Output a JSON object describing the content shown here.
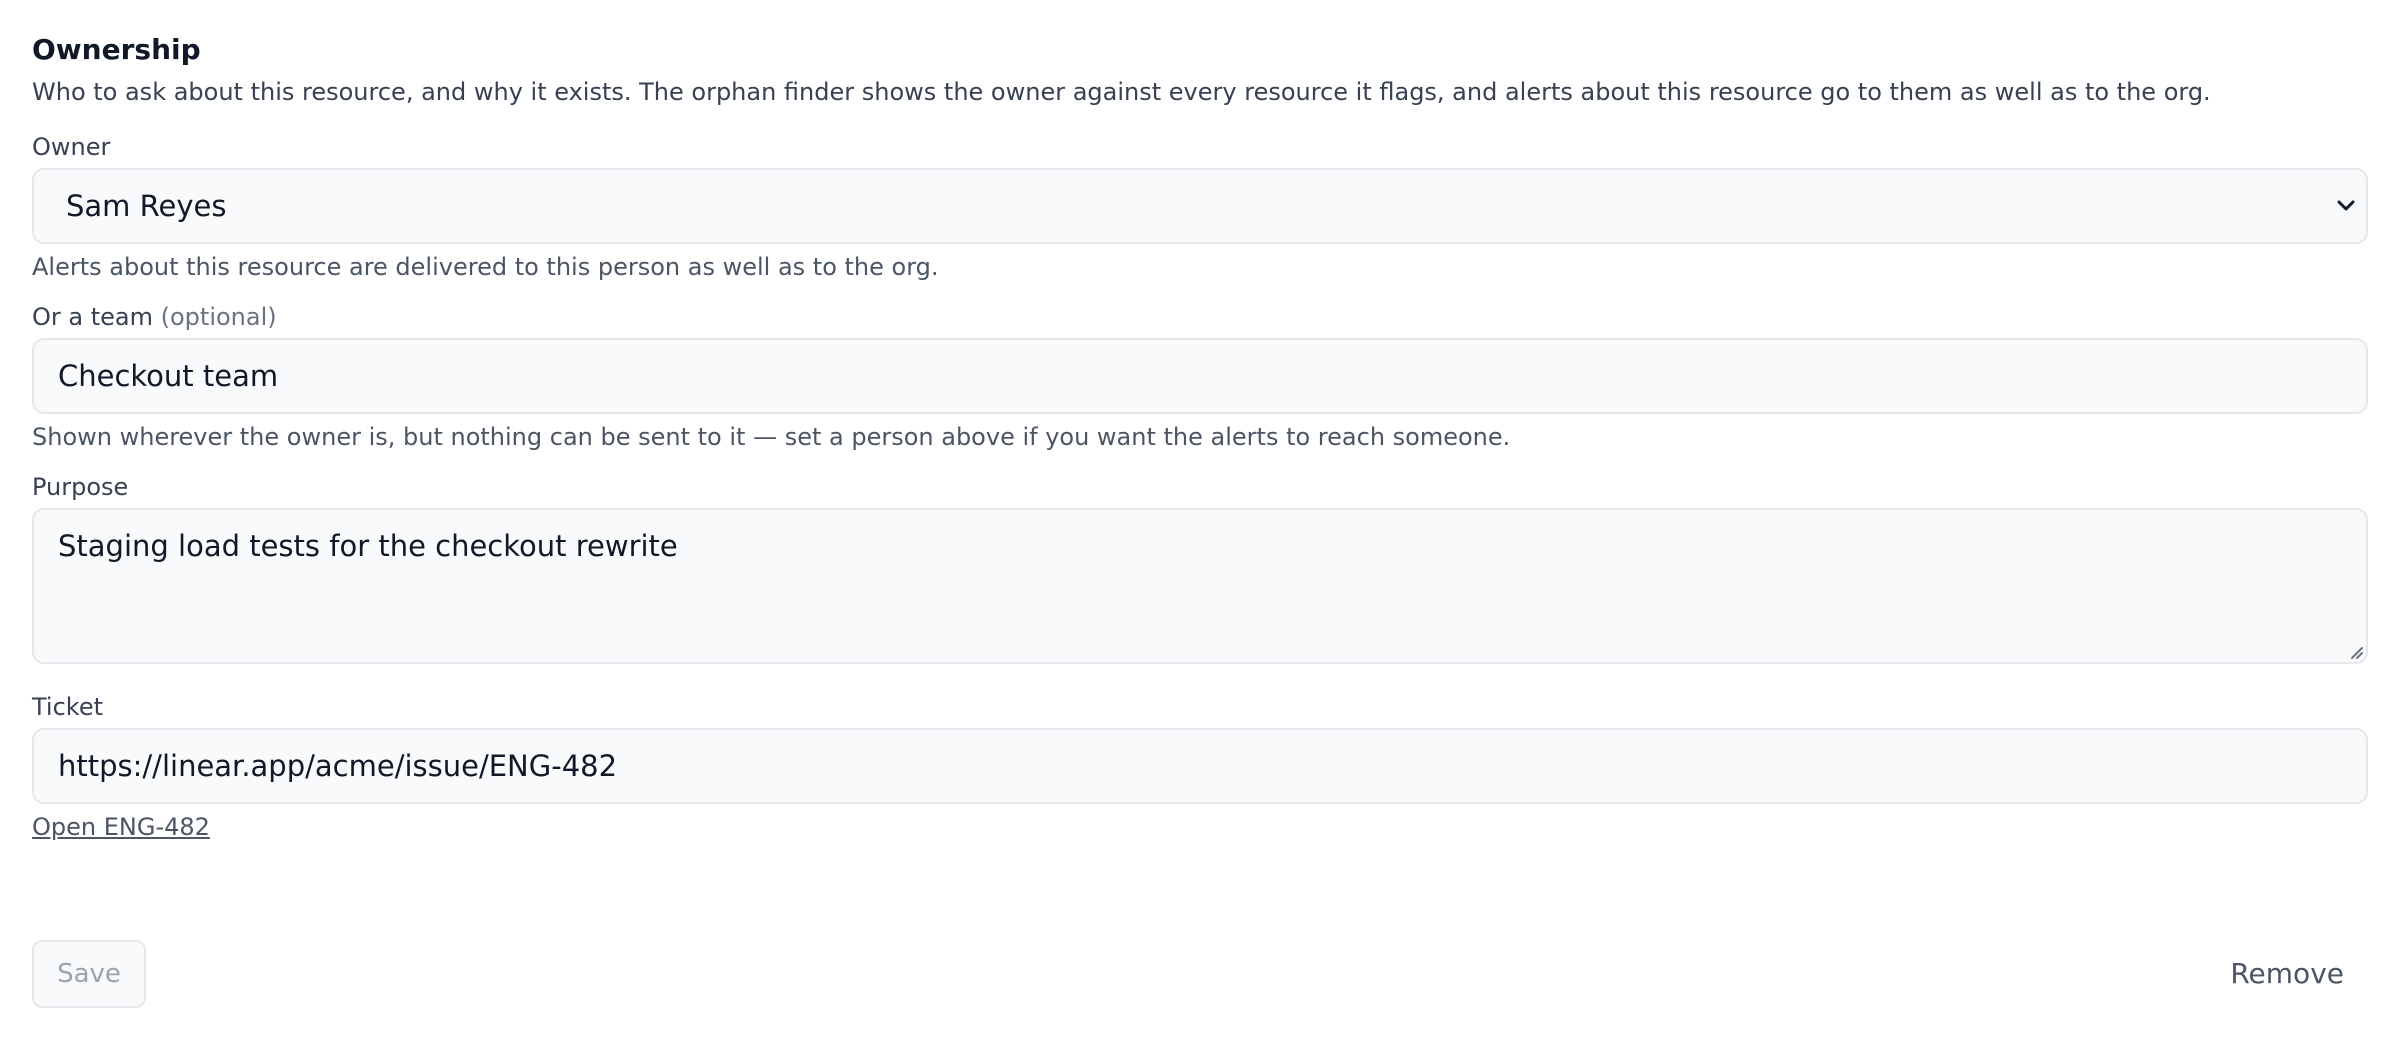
{
  "section": {
    "title": "Ownership",
    "description": "Who to ask about this resource, and why it exists. The orphan finder shows the owner against every resource it flags, and alerts about this resource go to them as well as to the org."
  },
  "owner": {
    "label": "Owner",
    "value": "Sam Reyes",
    "hint": "Alerts about this resource are delivered to this person as well as to the org."
  },
  "team": {
    "label": "Or a team",
    "optional": "(optional)",
    "value": "Checkout team",
    "hint": "Shown wherever the owner is, but nothing can be sent to it — set a person above if you want the alerts to reach someone."
  },
  "purpose": {
    "label": "Purpose",
    "value": "Staging load tests for the checkout rewrite"
  },
  "ticket": {
    "label": "Ticket",
    "value": "https://linear.app/acme/issue/ENG-482",
    "link_text": "Open ENG-482"
  },
  "actions": {
    "save_label": "Save",
    "remove_label": "Remove"
  },
  "icons": {
    "owner_select": "chevron-down-icon",
    "purpose_resize": "resize-grip-icon"
  }
}
